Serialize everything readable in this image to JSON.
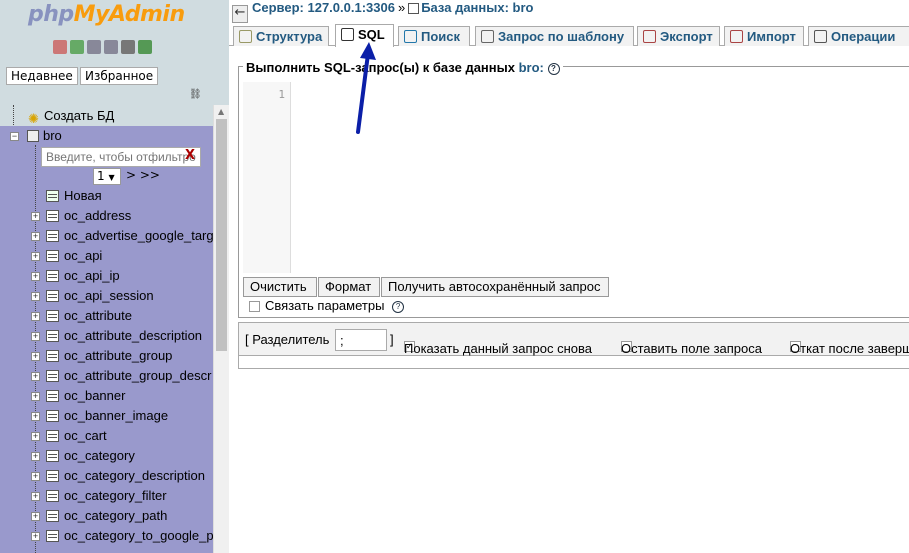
{
  "nav": {
    "logo_php": "php",
    "logo_rest": "MyAdmin",
    "tab_recent": "Недавнее",
    "tab_favorites": "Избранное",
    "create_db": "Создать БД",
    "db_name": "bro",
    "filter_placeholder": "Введите, чтобы отфильтровать",
    "filter_clear": "X",
    "page_value": "1",
    "page_next": "> >>",
    "new_table": "Новая",
    "tables": [
      "oc_address",
      "oc_advertise_google_targ",
      "oc_api",
      "oc_api_ip",
      "oc_api_session",
      "oc_attribute",
      "oc_attribute_description",
      "oc_attribute_group",
      "oc_attribute_group_descr",
      "oc_banner",
      "oc_banner_image",
      "oc_cart",
      "oc_category",
      "oc_category_description",
      "oc_category_filter",
      "oc_category_path",
      "oc_category_to_google_p"
    ]
  },
  "breadcrumb": {
    "server": "Сервер: 127.0.0.1:3306",
    "separator": "»",
    "database": "База данных: bro"
  },
  "tabs": [
    {
      "label": "Структура",
      "icon": "structure-icon"
    },
    {
      "label": "SQL",
      "icon": "sql-icon"
    },
    {
      "label": "Поиск",
      "icon": "search-icon"
    },
    {
      "label": "Запрос по шаблону",
      "icon": "query-icon"
    },
    {
      "label": "Экспорт",
      "icon": "export-icon"
    },
    {
      "label": "Импорт",
      "icon": "import-icon"
    },
    {
      "label": "Операции",
      "icon": "operations-icon"
    }
  ],
  "sql": {
    "legend": "Выполнить SQL-запрос(ы) к базе данных",
    "legend_db": "bro:",
    "line_number": "1",
    "btn_clear": "Очистить",
    "btn_format": "Формат",
    "btn_autosaved": "Получить автосохранённый запрос",
    "bind_params": "Связать параметры"
  },
  "options": {
    "delimiter_label": "[ Разделитель",
    "delimiter_value": ";",
    "delimiter_close": "]",
    "show_query": "Показать данный запрос снова",
    "keep_box": "Оставить поле запроса",
    "rollback": "Откат после завершения"
  },
  "colors": {
    "nav_bg": "#d0dce0",
    "tree_bg": "#9999cc",
    "link": "#235a81",
    "arrow": "#0b1fa8"
  }
}
